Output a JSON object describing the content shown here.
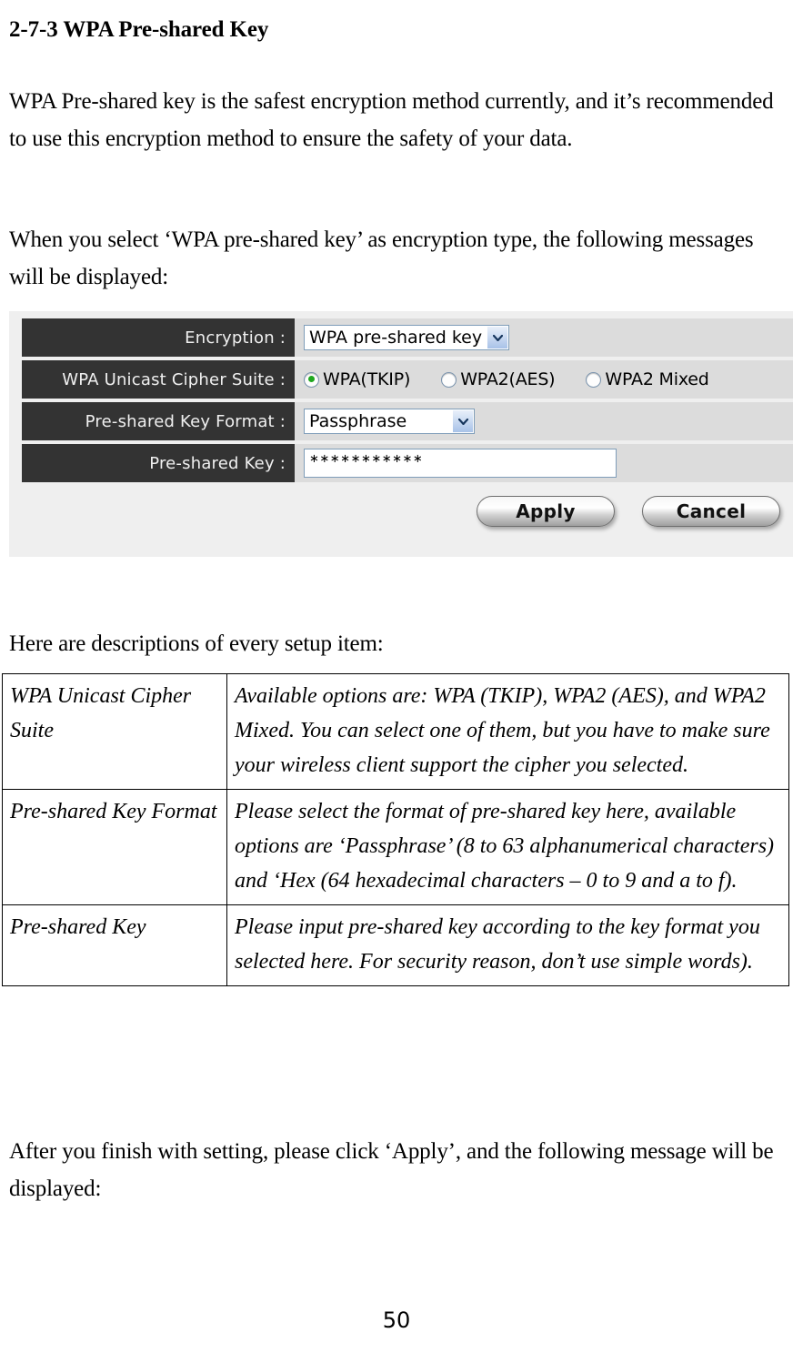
{
  "document": {
    "heading": "2-7-3 WPA Pre-shared Key",
    "paragraph_1": "WPA Pre-shared key is the safest encryption method currently, and it’s recommended to use this encryption method to ensure the safety of your data.",
    "paragraph_2": "When you select ‘WPA pre-shared key’ as encryption type, the following messages will be displayed:",
    "paragraph_3": "Here are descriptions of every setup item:",
    "paragraph_4": "After you finish with setting, please click ‘Apply’, and the following message will be displayed:",
    "page_number": "50"
  },
  "screenshot": {
    "rows": {
      "encryption": {
        "label": "Encryption :",
        "selected": "WPA pre-shared key",
        "arrow_icon": "chevron-down-icon"
      },
      "cipher_suite": {
        "label": "WPA Unicast Cipher Suite :",
        "options": [
          {
            "label": "WPA(TKIP)",
            "selected": true
          },
          {
            "label": "WPA2(AES)",
            "selected": false
          },
          {
            "label": "WPA2 Mixed",
            "selected": false
          }
        ]
      },
      "key_format": {
        "label": "Pre-shared Key Format :",
        "selected": "Passphrase",
        "arrow_icon": "chevron-down-icon"
      },
      "pre_shared_key": {
        "label": "Pre-shared Key :",
        "value": "∗∗∗∗∗∗∗∗∗∗∗"
      }
    },
    "buttons": {
      "apply": "Apply",
      "cancel": "Cancel"
    },
    "colors": {
      "label_bg": "#333333",
      "field_bg": "#dcdcdc",
      "panel_bg": "#efefef",
      "radio_selected": "#1fa81f",
      "select_border": "#7f9db9"
    }
  },
  "description_table": {
    "rows": [
      {
        "term": "WPA Unicast Cipher Suite",
        "definition": "Available options are: WPA (TKIP), WPA2 (AES), and WPA2 Mixed. You can select one of them, but you have to make sure your wireless client support the cipher you selected."
      },
      {
        "term": "Pre-shared Key Format",
        "definition": "Please select the format of pre-shared key here, available options are ‘Passphrase’ (8 to 63 alphanumerical characters) and ‘Hex (64 hexadecimal characters – 0 to 9 and a to f)."
      },
      {
        "term": "Pre-shared Key",
        "definition": "Please input pre-shared key according to the key format you selected here. For security reason, don’t use simple words)."
      }
    ]
  }
}
